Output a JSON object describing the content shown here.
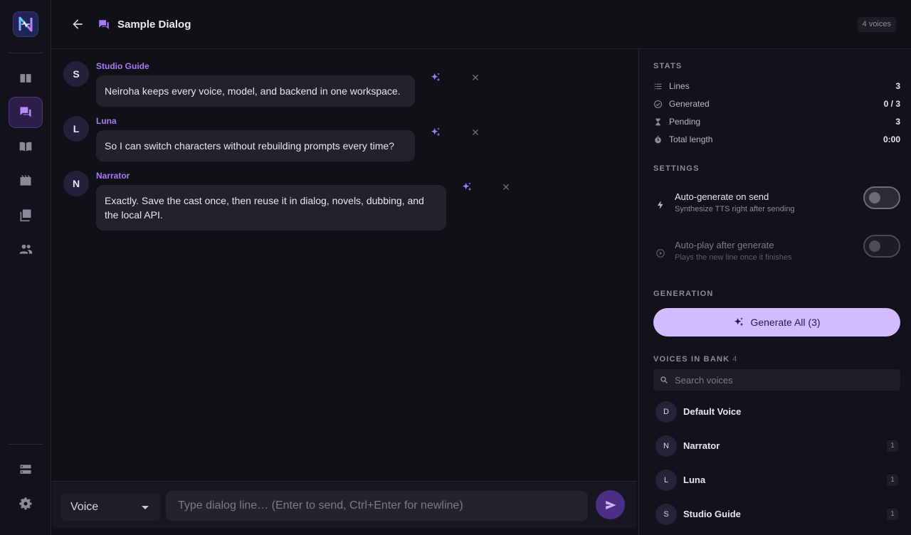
{
  "app": {
    "logo_letter": "N"
  },
  "rail": {
    "items": [
      {
        "name": "library",
        "icon": "book-icon"
      },
      {
        "name": "dialog",
        "icon": "chat-icon",
        "active": true
      },
      {
        "name": "novels",
        "icon": "open-book-icon"
      },
      {
        "name": "dubbing",
        "icon": "movie-icon"
      },
      {
        "name": "music",
        "icon": "music-library-icon"
      },
      {
        "name": "voices",
        "icon": "people-icon"
      }
    ],
    "bottom": [
      {
        "name": "backends",
        "icon": "server-icon"
      },
      {
        "name": "settings",
        "icon": "gear-icon"
      }
    ]
  },
  "header": {
    "title": "Sample Dialog",
    "voices_badge": "4 voices"
  },
  "messages": [
    {
      "initial": "S",
      "speaker": "Studio Guide",
      "text": "Neiroha keeps every voice, model, and backend in one workspace."
    },
    {
      "initial": "L",
      "speaker": "Luna",
      "text": "So I can switch characters without rebuilding prompts every time?"
    },
    {
      "initial": "N",
      "speaker": "Narrator",
      "text": "Exactly. Save the cast once, then reuse it in dialog, novels, dubbing, and the local API."
    }
  ],
  "composer": {
    "voice_label": "Voice",
    "placeholder": "Type dialog line… (Enter to send, Ctrl+Enter for newline)"
  },
  "panel": {
    "stats_title": "STATS",
    "stats": [
      {
        "label": "Lines",
        "value": "3",
        "icon": "list-icon"
      },
      {
        "label": "Generated",
        "value": "0 / 3",
        "icon": "check-circle-icon"
      },
      {
        "label": "Pending",
        "value": "3",
        "icon": "pending-icon"
      },
      {
        "label": "Total length",
        "value": "0:00",
        "icon": "timer-icon"
      }
    ],
    "settings_title": "SETTINGS",
    "settings": [
      {
        "title": "Auto-generate on send",
        "subtitle": "Synthesize TTS right after sending",
        "enabled": false
      },
      {
        "title": "Auto-play after generate",
        "subtitle": "Plays the new line once it finishes",
        "enabled": false
      }
    ],
    "generation_title": "GENERATION",
    "generate_button": "Generate All (3)",
    "voices_title": "VOICES IN BANK",
    "voices_count": "4",
    "search_placeholder": "Search voices",
    "voices": [
      {
        "initial": "D",
        "name": "Default Voice",
        "count": ""
      },
      {
        "initial": "N",
        "name": "Narrator",
        "count": "1"
      },
      {
        "initial": "L",
        "name": "Luna",
        "count": "1"
      },
      {
        "initial": "S",
        "name": "Studio Guide",
        "count": "1"
      }
    ]
  },
  "colors": {
    "accent": "#a97af5",
    "button": "#d0bcff",
    "background": "#101017"
  }
}
